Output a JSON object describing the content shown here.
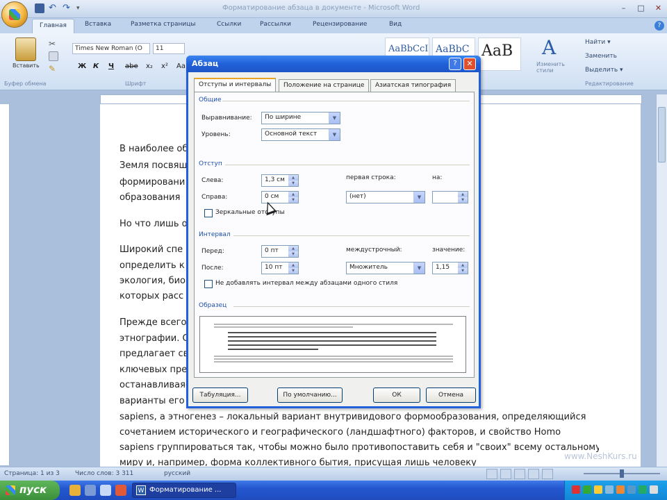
{
  "window": {
    "title": "Форматирование абзаца в документе - Microsoft Word",
    "controls": [
      "–",
      "□",
      "✕"
    ]
  },
  "quick_access": {
    "undo": "↶",
    "redo": "↷",
    "more": "▾"
  },
  "tabs": [
    "Главная",
    "Вставка",
    "Разметка страницы",
    "Ссылки",
    "Рассылки",
    "Рецензирование",
    "Вид"
  ],
  "ribbon": {
    "paste_label": "Вставить",
    "cut": "✂",
    "brush": "✎",
    "font_name": "Times New Roman (О",
    "font_size": "11",
    "format_buttons": [
      "Ж",
      "К",
      "Ч",
      "abe",
      "x₂",
      "x²",
      "Aa",
      "A"
    ],
    "styles": [
      "AaBbCcI",
      "AaBbC",
      "AaB"
    ],
    "change_styles_icon": "A",
    "change_styles_label": "Изменить стили",
    "editing": [
      "Найти ▾",
      "Заменить",
      "Выделить ▾"
    ],
    "group_labels": {
      "clipboard": "Буфер обмена",
      "font": "Шрифт",
      "editing": "Редактирование"
    }
  },
  "document": {
    "lines": [
      "В наиболее общем виде                                                     лиев и биосфера",
      "Земля посвящ                                                              щей средой, вопросам",
      "формировани                                                               ях и проблемам",
      "образования",
      "",
      "Но что лишь о",
      "",
      "Широкий   спе                                                         автора  не  позволяет",
      "определить    к                                                      науке.  Этнография,",
      "экология,  био                                                       онь областей знания, в",
      "которых расс",
      "",
      "Прежде всего,                                                        напрямую относится к",
      "этнографии. О                                                        ному вопросу и",
      "предлагает сво                                                       еловечества. Одним из",
      "ключевых пред                                                        Земли. Не",
      "останавливаясь                                                       атает различные",
      "варианты его                                                         ования вида Homo",
      "sapiens, а этногенез – локальный вариант внутривидового формообразования, определяющийся",
      "сочетанием исторического и географического (ландшафтного) факторов, и свойство Homo",
      "sapiens группироваться так, чтобы можно было противопоставить себя и \"своих\" всему остальному",
      "миру и, например, форма коллективного бытия, присущая лишь человеку"
    ]
  },
  "dialog": {
    "title": "Абзац",
    "help": "?",
    "close": "✕",
    "tabs": [
      "Отступы и интервалы",
      "Положение на странице",
      "Азиатская типография"
    ],
    "sections": {
      "general": "Общие",
      "indent": "Отступ",
      "spacing": "Интервал",
      "preview": "Образец"
    },
    "alignment": {
      "label": "Выравнивание:",
      "value": "По ширине"
    },
    "level": {
      "label": "Уровень:",
      "value": "Основной текст"
    },
    "indent_left": {
      "label": "Слева:",
      "value": "1,3 см"
    },
    "indent_right": {
      "label": "Справа:",
      "value": "0 см"
    },
    "first_line": {
      "label": "первая строка:",
      "value": "(нет)"
    },
    "first_line_by": {
      "label": "на:",
      "value": ""
    },
    "mirror_indents": "Зеркальные отступы",
    "spacing_before": {
      "label": "Перед:",
      "value": "0 пт"
    },
    "spacing_after": {
      "label": "После:",
      "value": "10 пт"
    },
    "line_spacing": {
      "label": "междустрочный:",
      "value": "Множитель"
    },
    "line_spacing_value": {
      "label": "значение:",
      "value": "1,15"
    },
    "no_space_same_style": "Не добавлять интервал между абзацами одного стиля",
    "preview_text": "Прежде всего, рассматриваемая тематика, непосредственно связана с этнографией",
    "buttons": {
      "tabs": "Табуляция...",
      "default": "По умолчанию...",
      "ok": "ОК",
      "cancel": "Отмена"
    }
  },
  "status": {
    "page": "Страница: 1 из 3",
    "words": "Число слов: 3 311",
    "lang": "русский"
  },
  "watermark": "www.NeshKurs.ru",
  "taskbar": {
    "start": "пуск",
    "task": "Форматирование ..."
  }
}
